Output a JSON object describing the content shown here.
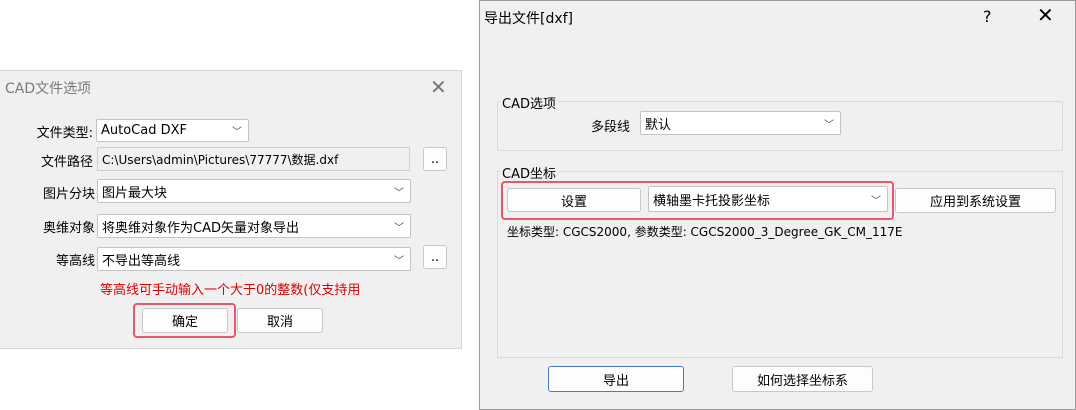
{
  "cad_dialog": {
    "title": "CAD文件选项",
    "close_icon": "close-icon",
    "fields": {
      "file_type": {
        "label": "文件类型:",
        "value": "AutoCad DXF"
      },
      "file_path": {
        "label": "文件路径",
        "value": "C:\\Users\\admin\\Pictures\\77777\\数据.dxf",
        "browse_label": ".."
      },
      "image_tiling": {
        "label": "图片分块",
        "value": "图片最大块"
      },
      "object_3d": {
        "label": "奥维对象",
        "value": "将奥维对象作为CAD矢量对象导出"
      },
      "contour": {
        "label": "等高线",
        "value": "不导出等高线",
        "browse_label": ".."
      }
    },
    "hint": "等高线可手动输入一个大于0的整数(仅支持用",
    "ok_label": "确定",
    "cancel_label": "取消",
    "hint_color": "#e00000",
    "highlight_color": "#e8586a"
  },
  "export_dialog": {
    "title": "导出文件[dxf]",
    "help_label": "?",
    "close_icon": "close-icon",
    "cad_options": {
      "legend": "CAD选项",
      "polyline_label": "多段线",
      "polyline_value": "默认"
    },
    "cad_coords": {
      "legend": "CAD坐标",
      "settings_label": "设置",
      "projection_value": "横轴墨卡托投影坐标",
      "apply_label": "应用到系统设置",
      "coord_info": "坐标类型: CGCS2000, 参数类型: CGCS2000_3_Degree_GK_CM_117E"
    },
    "export_label": "导出",
    "how_to_choose_label": "如何选择坐标系"
  }
}
